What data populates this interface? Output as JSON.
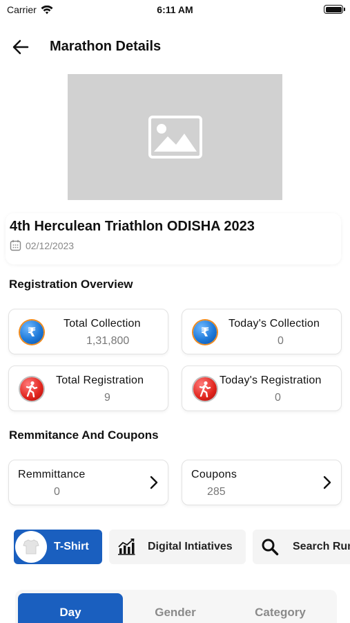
{
  "status_bar": {
    "carrier": "Carrier",
    "time": "6:11 AM"
  },
  "header": {
    "title": "Marathon Details",
    "back_icon": "arrow-left-icon"
  },
  "banner": {
    "icon": "image-placeholder-icon"
  },
  "event": {
    "title": "4th Herculean Triathlon ODISHA 2023",
    "date": "02/12/2023",
    "date_icon": "calendar-icon"
  },
  "registration_overview": {
    "title": "Registration Overview",
    "cards": [
      {
        "label": "Total Collection",
        "value": "1,31,800",
        "icon": "rupee-icon"
      },
      {
        "label": "Today's Collection",
        "value": "0",
        "icon": "rupee-icon"
      },
      {
        "label": "Total Registration",
        "value": "9",
        "icon": "runner-icon"
      },
      {
        "label": "Today's Registration",
        "value": "0",
        "icon": "runner-icon"
      }
    ]
  },
  "remittance_coupons": {
    "title": "Remmitance And Coupons",
    "cards": [
      {
        "label": "Remmittance",
        "value": "0"
      },
      {
        "label": "Coupons",
        "value": "285"
      }
    ]
  },
  "chips": [
    {
      "label": "T-Shirt",
      "icon": "tshirt-icon",
      "active": true
    },
    {
      "label": "Digital Intiatives",
      "icon": "bar-chart-icon",
      "active": false
    },
    {
      "label": "Search Run",
      "icon": "search-icon",
      "active": false
    }
  ],
  "tabs": [
    {
      "label": "Day",
      "active": true
    },
    {
      "label": "Gender",
      "active": false
    },
    {
      "label": "Category",
      "active": false
    }
  ],
  "colors": {
    "primary": "#1a5fbf",
    "rupee_blue": "#1f7ad9",
    "runner_red": "#e0241c",
    "placeholder_gray": "#d1d1d1"
  }
}
